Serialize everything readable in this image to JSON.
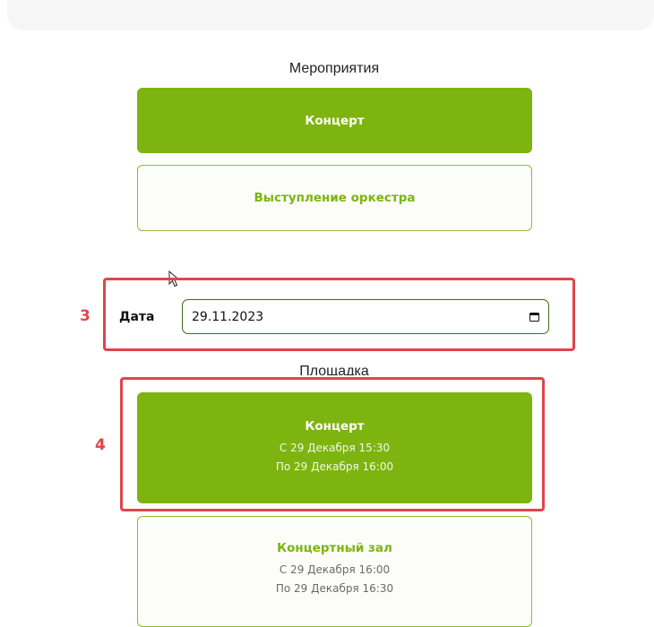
{
  "events": {
    "heading": "Мероприятия",
    "items": [
      {
        "label": "Концерт"
      },
      {
        "label": "Выступление оркестра"
      }
    ]
  },
  "date": {
    "label": "Дата",
    "value": "29.11.2023"
  },
  "venues": {
    "heading": "Площадка",
    "items": [
      {
        "title": "Концерт",
        "from": "С 29 Декабря 15:30",
        "to": "По 29 Декабря 16:00"
      },
      {
        "title": "Концертный зал",
        "from": "С 29 Декабря 16:00",
        "to": "По 29 Декабря 16:30"
      }
    ]
  },
  "annotations": {
    "date_marker": "3",
    "venue_marker": "4"
  },
  "colors": {
    "accent": "#7db40f",
    "annotation": "#e0454a"
  },
  "icons": {
    "date_picker": "calendar-icon",
    "pointer": "mouse-cursor-icon"
  }
}
